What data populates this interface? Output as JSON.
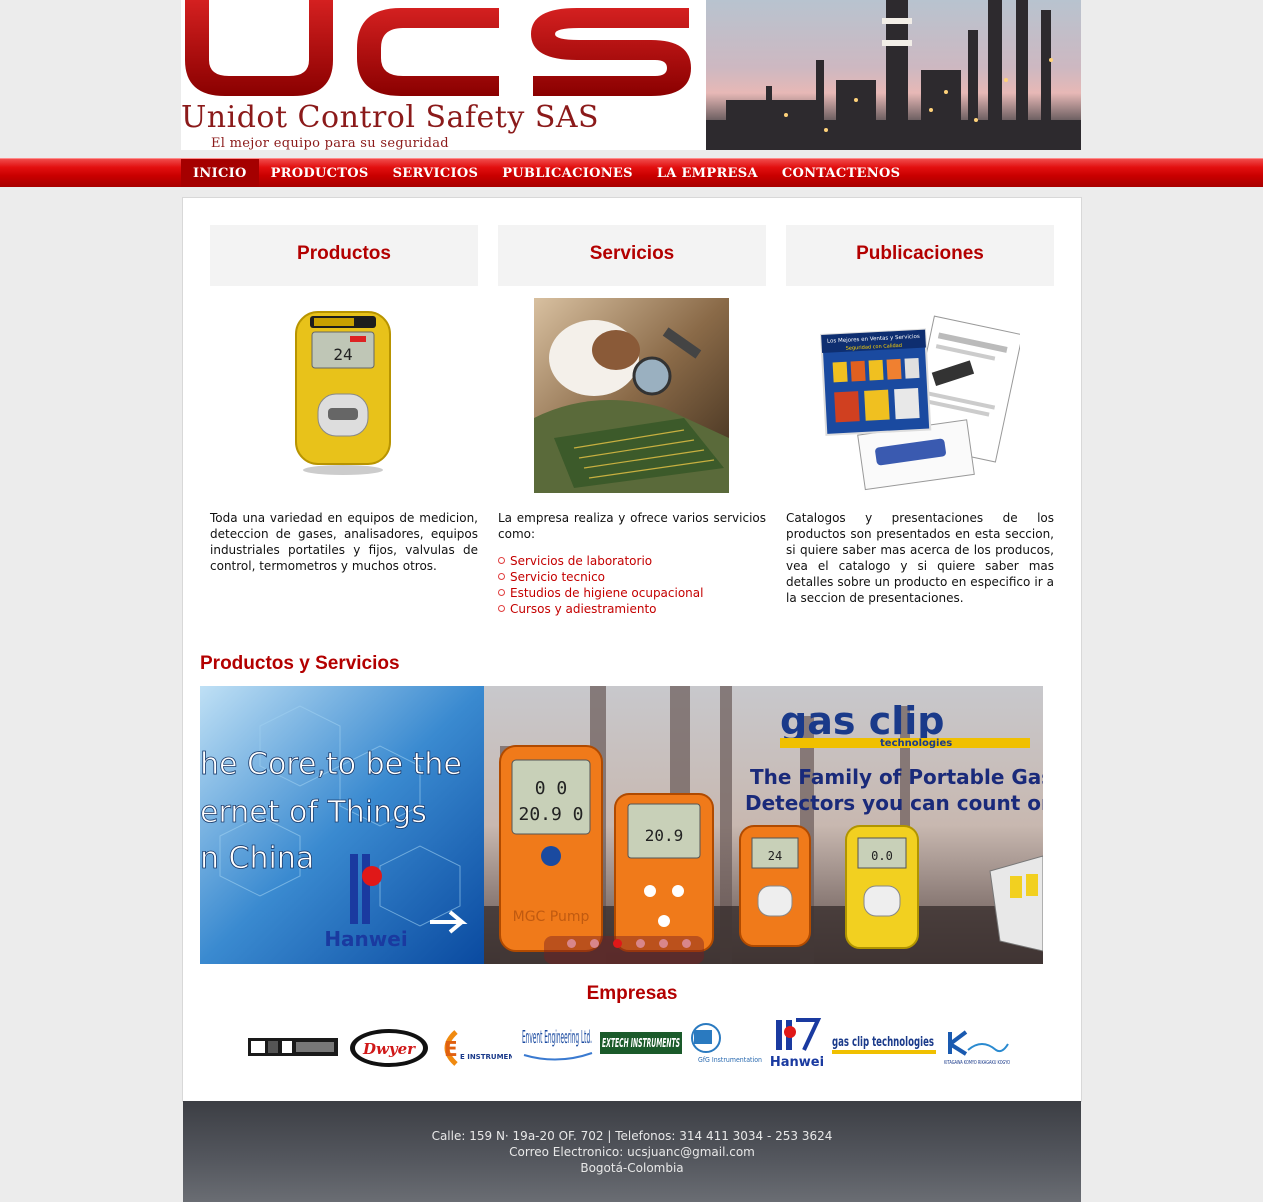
{
  "header": {
    "logo_letters": "UCS",
    "company_name": "Unidot Control Safety SAS",
    "slogan": "El mejor equipo para su seguridad"
  },
  "nav": {
    "items": [
      {
        "label": "INICIO",
        "active": true
      },
      {
        "label": "PRODUCTOS",
        "active": false
      },
      {
        "label": "SERVICIOS",
        "active": false
      },
      {
        "label": "PUBLICACIONES",
        "active": false
      },
      {
        "label": "LA EMPRESA",
        "active": false
      },
      {
        "label": "CONTACTENOS",
        "active": false
      }
    ]
  },
  "columns": {
    "productos": {
      "title": "Productos",
      "text": "Toda una variedad en equipos de medicion, deteccion de gases, analisadores, equipos industriales portatiles y fijos, valvulas de control, termometros y muchos otros.",
      "device_reading": "24"
    },
    "servicios": {
      "title": "Servicios",
      "intro": "La empresa realiza y ofrece varios servicios como:",
      "list": [
        "Servicios de laboratorio",
        "Servicio tecnico",
        "Estudios de higiene ocupacional",
        "Cursos y adiestramiento"
      ]
    },
    "publicaciones": {
      "title": "Publicaciones",
      "text": "Catalogos y presentaciones de los productos son presentados en esta seccion, si quiere saber mas acerca de los producos, vea el catalogo y si quiere saber mas detalles sobre un producto en especifico ir a la seccion de presentaciones.",
      "brochure_heading": "Los Mejores en Ventas y Servicios",
      "brochure_sub": "Seguridad con Calidad"
    }
  },
  "productos_servicios": {
    "title": "Productos y Servicios",
    "slide_left": {
      "line1": "he Core,to be the",
      "line2": "ernet of Things",
      "line3": "n China",
      "brand": "Hanwei"
    },
    "slide_right": {
      "brand": "gas clip",
      "brand_sub": "technologies",
      "tagline1": "The Family of Portable Gas",
      "tagline2": "Detectors you can count on",
      "device1_label": "MGC Pump",
      "device1_reading1": "0  0",
      "device1_reading2": "20.9  0",
      "device2_reading": "20.9",
      "device3_reading": "24",
      "device4_reading": "0.0"
    },
    "slider_dots": 6,
    "active_dot": 3
  },
  "empresas": {
    "title": "Empresas",
    "logos": [
      "Dwyer",
      "E INSTRUMENTS",
      "Envent Engineering Ltd.",
      "EXTECH INSTRUMENTS",
      "GfG Instrumentation",
      "Hanwei",
      "gas clip technologies",
      "KITAGAWA KOMYO RIKAGAKU KOGYO"
    ]
  },
  "footer": {
    "line1": "Calle: 159 N· 19a-20 OF. 702 | Telefonos: 314 411 3034 - 253 3624",
    "line2": "Correo Electronico: ucsjuanc@gmail.com",
    "line3": "Bogotá-Colombia"
  },
  "colors": {
    "brand_red": "#b30000",
    "nav_red": "#d40000",
    "logo_red": "#8b1a1a"
  }
}
